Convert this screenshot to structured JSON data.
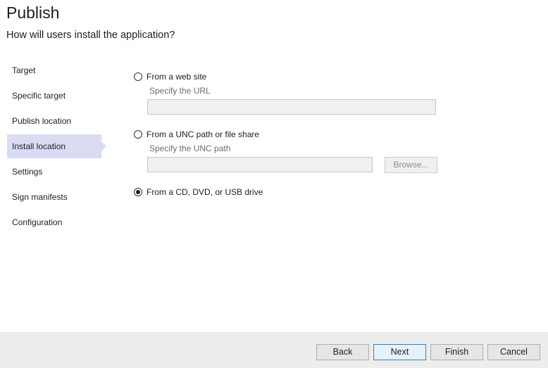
{
  "header": {
    "title": "Publish",
    "subtitle": "How will users install the application?"
  },
  "nav": {
    "items": [
      {
        "label": "Target",
        "selected": false
      },
      {
        "label": "Specific target",
        "selected": false
      },
      {
        "label": "Publish location",
        "selected": false
      },
      {
        "label": "Install location",
        "selected": true
      },
      {
        "label": "Settings",
        "selected": false
      },
      {
        "label": "Sign manifests",
        "selected": false
      },
      {
        "label": "Configuration",
        "selected": false
      }
    ]
  },
  "options": {
    "web": {
      "label": "From a web site",
      "hint": "Specify the URL",
      "value": "",
      "checked": false
    },
    "unc": {
      "label": "From a UNC path or file share",
      "hint": "Specify the UNC path",
      "value": "",
      "checked": false,
      "browse_label": "Browse..."
    },
    "cd": {
      "label": "From a CD, DVD, or USB drive",
      "checked": true
    }
  },
  "footer": {
    "back_label": "Back",
    "next_label": "Next",
    "finish_label": "Finish",
    "cancel_label": "Cancel"
  },
  "colors": {
    "selected_nav_bg": "#dadcf5",
    "footer_bg": "#ededed",
    "primary_button_border": "#3c7fb1"
  }
}
